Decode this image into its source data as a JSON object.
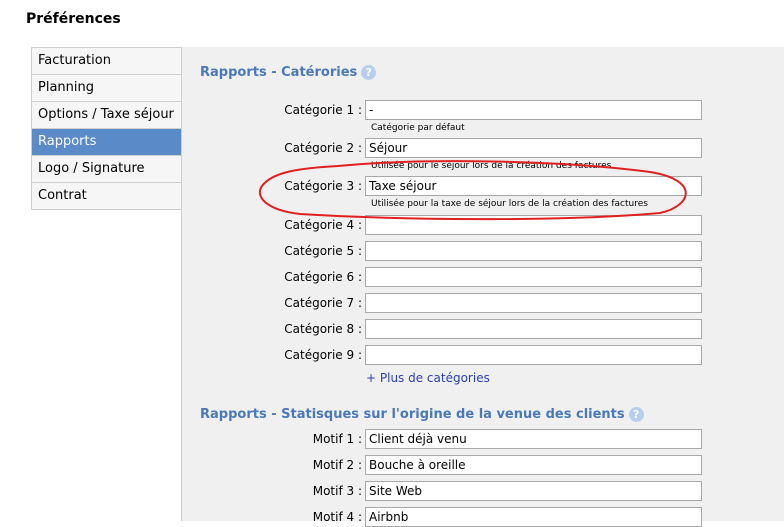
{
  "page": {
    "title": "Préférences"
  },
  "sidebar": {
    "items": [
      {
        "label": "Facturation",
        "active": false
      },
      {
        "label": "Planning",
        "active": false
      },
      {
        "label": "Options / Taxe séjour",
        "active": false
      },
      {
        "label": "Rapports",
        "active": true
      },
      {
        "label": "Logo / Signature",
        "active": false
      },
      {
        "label": "Contrat",
        "active": false
      }
    ]
  },
  "categories_section": {
    "title": "Rapports - Catérories",
    "help_icon": "help-icon",
    "rows": [
      {
        "label": "Catégorie 1 :",
        "value": "-",
        "hint": "Catégorie par défaut"
      },
      {
        "label": "Catégorie 2 :",
        "value": "Séjour",
        "hint": "Utilisée pour le séjour lors de la création des factures"
      },
      {
        "label": "Catégorie 3 :",
        "value": "Taxe séjour",
        "hint": "Utilisée pour la taxe de séjour lors de la création des factures"
      },
      {
        "label": "Catégorie 4 :",
        "value": ""
      },
      {
        "label": "Catégorie 5 :",
        "value": ""
      },
      {
        "label": "Catégorie 6 :",
        "value": ""
      },
      {
        "label": "Catégorie 7 :",
        "value": ""
      },
      {
        "label": "Catégorie 8 :",
        "value": ""
      },
      {
        "label": "Catégorie 9 :",
        "value": ""
      }
    ],
    "more_link": "+ Plus de catégories"
  },
  "origin_section": {
    "title": "Rapports - Statisques sur l'origine de la venue des clients",
    "help_icon": "help-icon",
    "rows": [
      {
        "label": "Motif 1 :",
        "value": "Client déjà venu"
      },
      {
        "label": "Motif 2 :",
        "value": "Bouche à oreille"
      },
      {
        "label": "Motif 3 :",
        "value": "Site Web"
      },
      {
        "label": "Motif 4 :",
        "value": "Airbnb"
      }
    ]
  },
  "colors": {
    "accent": "#4a79b8",
    "active_tab": "#5a8ac7",
    "annotation": "#e02020",
    "link": "#2a3fb0"
  }
}
